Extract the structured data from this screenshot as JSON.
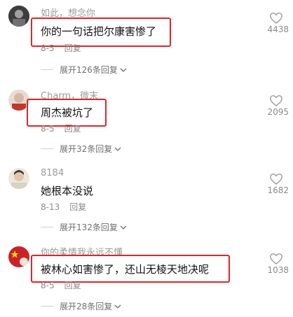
{
  "comments": [
    {
      "username": "如此，想念你",
      "text": "你的一句话把尔康害惨了",
      "date": "8-5",
      "reply_label": "回复",
      "expand_label": "展开126条回复",
      "likes": "4438",
      "highlighted": true,
      "avatar_color": "#4a4a4a"
    },
    {
      "username": "Charm，微末",
      "text": "周杰被坑了",
      "date": "8-5",
      "reply_label": "回复",
      "expand_label": "展开32条回复",
      "likes": "2095",
      "highlighted": true,
      "avatar_color": "#c94a4a"
    },
    {
      "username": "8184",
      "text": "她根本没说",
      "date": "8-13",
      "reply_label": "回复",
      "expand_label": "展开132条回复",
      "likes": "1682",
      "highlighted": false,
      "avatar_color": "#8a7a62"
    },
    {
      "username": "你的柔情我永远不懂",
      "text": "被林心如害惨了，还山无棱天地决呢",
      "date": "8-5",
      "reply_label": "回复",
      "expand_label": "展开28条回复",
      "likes": "1038",
      "highlighted": true,
      "avatar_color": "#c8222a"
    }
  ],
  "colors": {
    "highlight": "#e0242b",
    "text": "#111111",
    "muted": "#8a8a8a"
  }
}
